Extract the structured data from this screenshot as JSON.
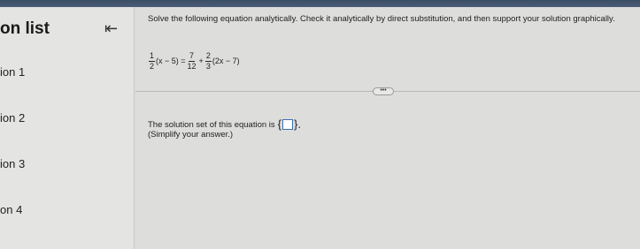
{
  "sidebar": {
    "title": "on list",
    "collapse_icon": "collapse-left-icon",
    "items": [
      {
        "label": "ion 1"
      },
      {
        "label": "ion 2"
      },
      {
        "label": "ion 3"
      },
      {
        "label": "on 4"
      }
    ]
  },
  "question": {
    "instructions": "Solve the following equation analytically. Check it analytically by direct substitution, and then support your solution graphically.",
    "equation": {
      "term1_num": "1",
      "term1_den": "2",
      "term1_expr": "(x − 5) =",
      "term2_num": "7",
      "term2_den": "12",
      "plus": "+",
      "term3_num": "2",
      "term3_den": "3",
      "term3_expr": "(2x − 7)"
    },
    "more_label": "•••",
    "answer_prefix": "The solution set of this equation is",
    "brace_open": "{",
    "brace_close": "}.",
    "hint": "(Simplify your answer.)"
  }
}
